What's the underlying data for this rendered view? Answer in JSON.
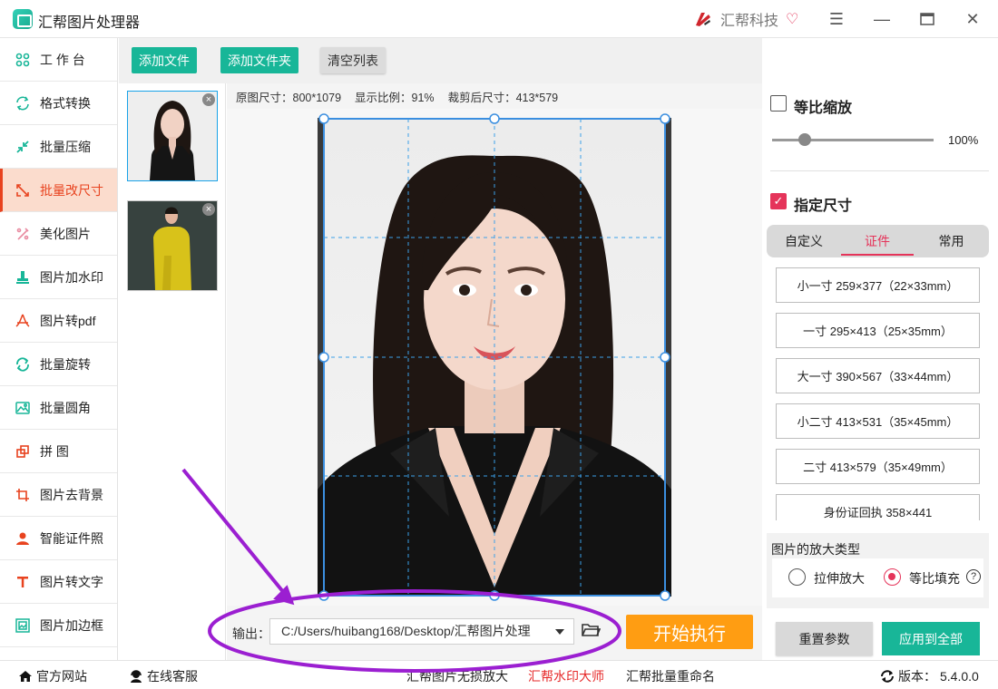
{
  "app": {
    "title": "汇帮图片处理器",
    "brand": "汇帮科技"
  },
  "sidebar": {
    "items": [
      {
        "label": "工 作 台",
        "icon": "workbench-icon",
        "active": false
      },
      {
        "label": "格式转换",
        "icon": "format-convert-icon",
        "active": false
      },
      {
        "label": "批量压缩",
        "icon": "compress-icon",
        "active": false
      },
      {
        "label": "批量改尺寸",
        "icon": "resize-icon",
        "active": true
      },
      {
        "label": "美化图片",
        "icon": "beautify-icon",
        "active": false
      },
      {
        "label": "图片加水印",
        "icon": "watermark-icon",
        "active": false
      },
      {
        "label": "图片转pdf",
        "icon": "pdf-icon",
        "active": false
      },
      {
        "label": "批量旋转",
        "icon": "rotate-icon",
        "active": false
      },
      {
        "label": "批量圆角",
        "icon": "round-corner-icon",
        "active": false
      },
      {
        "label": "拼    图",
        "icon": "collage-icon",
        "active": false
      },
      {
        "label": "图片去背景",
        "icon": "crop-icon",
        "active": false
      },
      {
        "label": "智能证件照",
        "icon": "id-photo-icon",
        "active": false
      },
      {
        "label": "图片转文字",
        "icon": "text-icon",
        "active": false
      },
      {
        "label": "图片加边框",
        "icon": "frame-icon",
        "active": false
      }
    ]
  },
  "toolbar": {
    "add_file": "添加文件",
    "add_folder": "添加文件夹",
    "clear_list": "清空列表"
  },
  "info": {
    "original_size": "原图尺寸：800*1079",
    "display_ratio": "显示比例：91%",
    "cropped_size": "裁剪后尺寸：413*579"
  },
  "output": {
    "label": "输出：",
    "path": "C:/Users/huibang168/Desktop/汇帮图片处理",
    "start": "开始执行"
  },
  "right": {
    "proportional_label": "等比缩放",
    "proportional_checked": false,
    "scale_percent": "100%",
    "scale_value": 0.2,
    "size_label": "指定尺寸",
    "size_checked": true,
    "tabs": [
      "自定义",
      "证件",
      "常用"
    ],
    "active_tab": "证件",
    "sizes": [
      "小一寸 259×377（22×33mm）",
      "一寸 295×413（25×35mm）",
      "大一寸 390×567（33×44mm）",
      "小二寸 413×531（35×45mm）",
      "二寸 413×579（35×49mm）",
      "身份证回执 358×441"
    ],
    "scale_type_title": "图片的放大类型",
    "stretch_label": "拉伸放大",
    "fill_label": "等比填充",
    "selected_scale_type": "等比填充",
    "reset": "重置参数",
    "apply_all": "应用到全部"
  },
  "statusbar": {
    "website": "官方网站",
    "service": "在线客服",
    "link1": "汇帮图片无损放大",
    "link2": "汇帮水印大师",
    "link3": "汇帮批量重命名",
    "version_label": "版本：",
    "version": "5.4.0.0"
  },
  "colors": {
    "accent_green": "#18b698",
    "accent_red": "#e5345a",
    "active_side_bg": "#fbdccd",
    "start_orange": "#ff9d12",
    "annotation_purple": "#9b1fd1"
  }
}
